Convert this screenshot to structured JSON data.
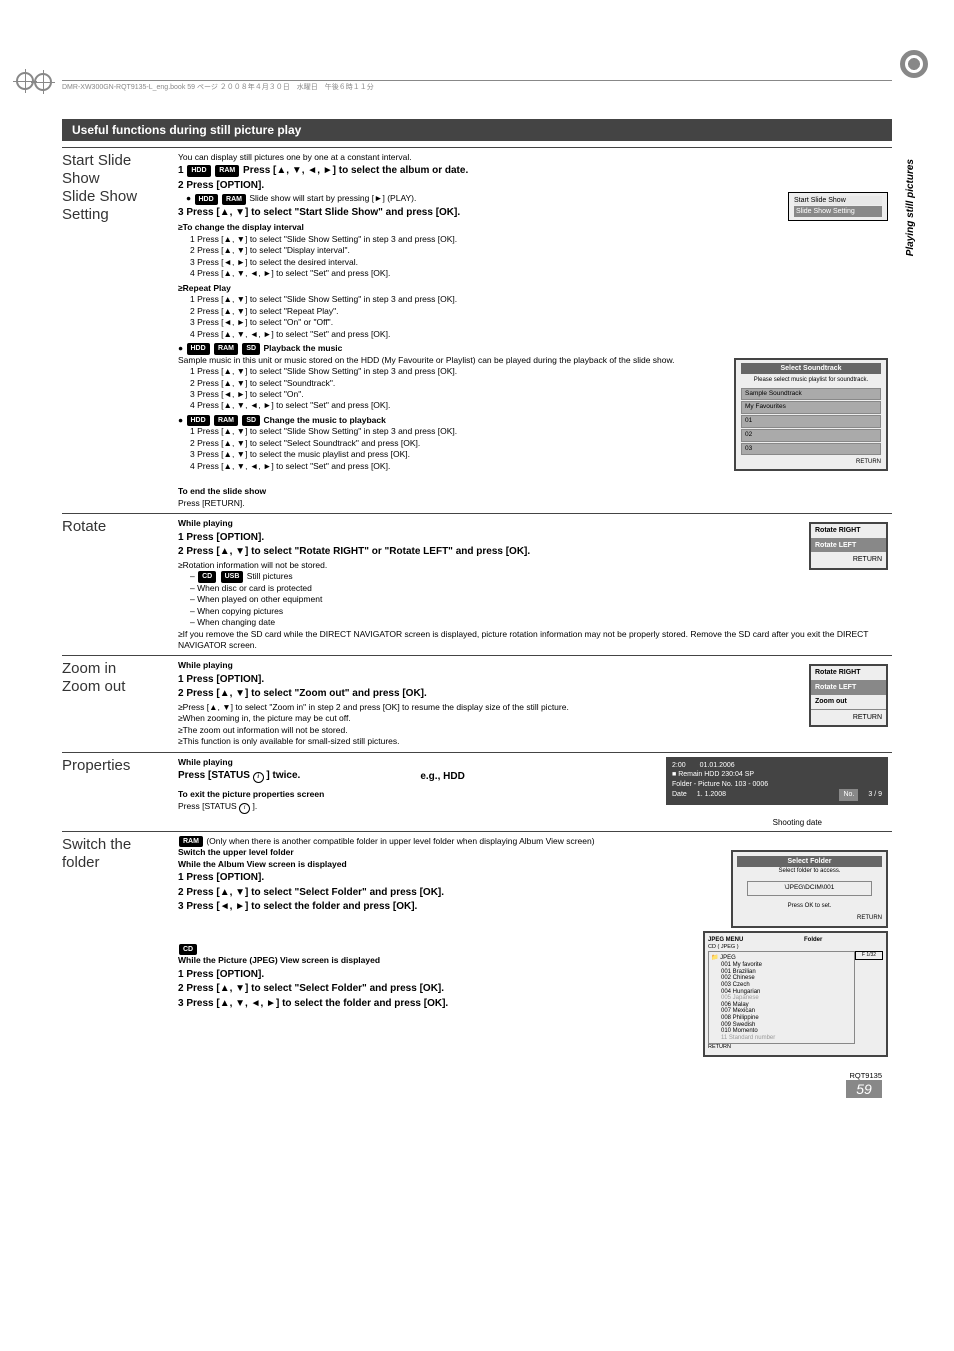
{
  "header_filename": "DMR-XW300GN-RQT9135-L_eng.book  59 ページ  ２００８年４月３０日　水曜日　午後６時１１分",
  "side_label": "Playing still pictures",
  "section_title": "Useful functions during still picture play",
  "row1": {
    "left1": "Start Slide Show",
    "left2": "Slide Show Setting",
    "intro": "You can display still pictures one by one at a constant interval.",
    "tag_hdd": "HDD",
    "tag_ram": "RAM",
    "tag_sd": "SD",
    "step1": "Press [▲, ▼, ◄, ►] to select the album or date.",
    "step2": "Press [OPTION].",
    "step2_bullet": "Slide show will start by pressing  [►] (PLAY).",
    "step3": "Press [▲, ▼] to select \"Start Slide Show\" and press [OK].",
    "change_interval": "≥To change the display interval",
    "ci1": "Press [▲, ▼] to select \"Slide Show Setting\" in step 3 and press [OK].",
    "ci2": "Press [▲, ▼] to select \"Display interval\".",
    "ci3": "Press [◄, ►] to select the desired interval.",
    "ci4": "Press [▲, ▼, ◄, ►] to select \"Set\" and press [OK].",
    "repeat": "≥Repeat Play",
    "rp1": "Press [▲, ▼] to select \"Slide Show Setting\" in step 3 and press [OK].",
    "rp2": "Press [▲, ▼] to select \"Repeat Play\".",
    "rp3": "Press [◄, ►] to select \"On\" or \"Off\".",
    "rp4": "Press [▲, ▼, ◄, ►] to select \"Set\" and press [OK].",
    "playback_music_hdr": "Playback the music",
    "playback_music": "Sample music in this unit or music stored on the HDD (My Favourite or Playlist) can be played during the playback of the slide show.",
    "pm1": "Press [▲, ▼] to select \"Slide Show Setting\" in step 3 and press [OK].",
    "pm2": "Press [▲, ▼] to select \"Soundtrack\".",
    "pm3": "Press [◄, ►] to select \"On\".",
    "pm4": "Press [▲, ▼, ◄, ►] to select \"Set\" and press [OK].",
    "change_music_hdr": "Change the music to playback",
    "cm1": "Press [▲, ▼] to select \"Slide Show Setting\" in step 3 and press [OK].",
    "cm2": "Press [▲, ▼] to select \"Select Soundtrack\" and press [OK].",
    "cm3": "Press [▲, ▼] to select the music playlist and press [OK].",
    "cm4": "Press [▲, ▼, ◄, ►] to select \"Set\" and press [OK].",
    "end_hdr": "To end the slide show",
    "end_txt": "Press [RETURN].",
    "popup1a": "Start Slide Show",
    "popup1b": "Slide Show Setting",
    "popup2_title": "Select Soundtrack",
    "popup2_sub": "Please select music playlist for soundtrack.",
    "popup2_items": [
      "Sample Soundtrack",
      "My Favourites",
      "01",
      "02",
      "03"
    ],
    "popup2_return": "RETURN"
  },
  "row2": {
    "left": "Rotate",
    "while": "While playing",
    "s1": "Press [OPTION].",
    "s2": "Press [▲, ▼] to select \"Rotate RIGHT\" or \"Rotate LEFT\" and press [OK].",
    "b1": "≥Rotation information will not be stored.",
    "tag_cd": "CD",
    "tag_usb": "USB",
    "b1a": "Still pictures",
    "b1b": "– When disc or card is protected",
    "b1c": "– When played on other equipment",
    "b1d": "– When copying pictures",
    "b1e": "– When changing date",
    "b2": "≥If you remove the SD card while the DIRECT NAVIGATOR screen is displayed, picture rotation information may not be properly stored. Remove the SD card after you exit the DIRECT NAVIGATOR screen.",
    "popup_r1": "Rotate RIGHT",
    "popup_r2": "Rotate LEFT",
    "popup_return": "RETURN"
  },
  "row3": {
    "left1": "Zoom in",
    "left2": "Zoom out",
    "while": "While playing",
    "s1": "Press [OPTION].",
    "s2": "Press [▲, ▼] to select \"Zoom out\" and press [OK].",
    "b1": "≥Press [▲, ▼] to select \"Zoom in\" in step 2 and press [OK] to resume the display size of the still picture.",
    "b2": "≥When zooming in, the picture may be cut off.",
    "b3": "≥The zoom out information will not be stored.",
    "b4": "≥This function is only available for small-sized still pictures.",
    "popup_r1": "Rotate RIGHT",
    "popup_r2": "Rotate LEFT",
    "popup_r3": "Zoom out",
    "popup_return": "RETURN"
  },
  "row4": {
    "left": "Properties",
    "while": "While playing",
    "press": "Press [STATUS     ] twice.",
    "eg": "e.g., HDD",
    "exit_hdr": "To exit the picture properties screen",
    "exit_txt": "Press [STATUS     ].",
    "shoot": "Shooting date",
    "p_time": "2:00",
    "p_date1": "01.01.2006",
    "p_remain": "Remain HDD 230:04 SP",
    "p_folder": "Folder - Picture No.  103 - 0006",
    "p_date_lbl": "Date",
    "p_date2": "1. 1.2008",
    "p_no_lbl": "No.",
    "p_no_val": "3 /  9"
  },
  "row5": {
    "left": "Switch the folder",
    "tag_ram": "RAM",
    "tag_cd": "CD",
    "note_ram": "(Only when there is another compatible folder in upper level folder when displaying Album View screen)",
    "switch_bold": "Switch the upper level folder",
    "while1": "While the Album View screen is displayed",
    "s1": "Press [OPTION].",
    "s2": "Press [▲, ▼] to select \"Select Folder\" and press [OK].",
    "s3": "Press [◄, ►] to select the folder and press [OK].",
    "while2": "While the Picture (JPEG) View screen is displayed",
    "c1": "Press [OPTION].",
    "c2": "Press [▲, ▼] to select \"Select Folder\" and press [OK].",
    "c3": "Press [▲, ▼, ◄, ►] to select the folder and press [OK].",
    "popup_sf_title": "Select Folder",
    "popup_sf_sub": "Select folder to access.",
    "popup_sf_item": "\\JPEG\\DCIM\\001",
    "popup_sf_press": "Press OK to set.",
    "popup_sf_return": "RETURN",
    "jpeg_title": "JPEG MENU",
    "jpeg_folder": "Folder",
    "jpeg_cd": "CD ( JPEG )",
    "jpeg_root": "JPEG",
    "jpeg_tree": [
      "001 My favorite",
      "001 Brazilian",
      "002 Chinese",
      "003 Czech",
      "004 Hungarian",
      "005 Japanese",
      "006 Malay",
      "007 Mexican",
      "008 Philippine",
      "009 Swedish",
      "010 Momento",
      "11 Standard number"
    ],
    "jpeg_f": "F  1/32",
    "jpeg_return": "RETURN"
  },
  "footer_code": "RQT9135",
  "footer_page": "59"
}
